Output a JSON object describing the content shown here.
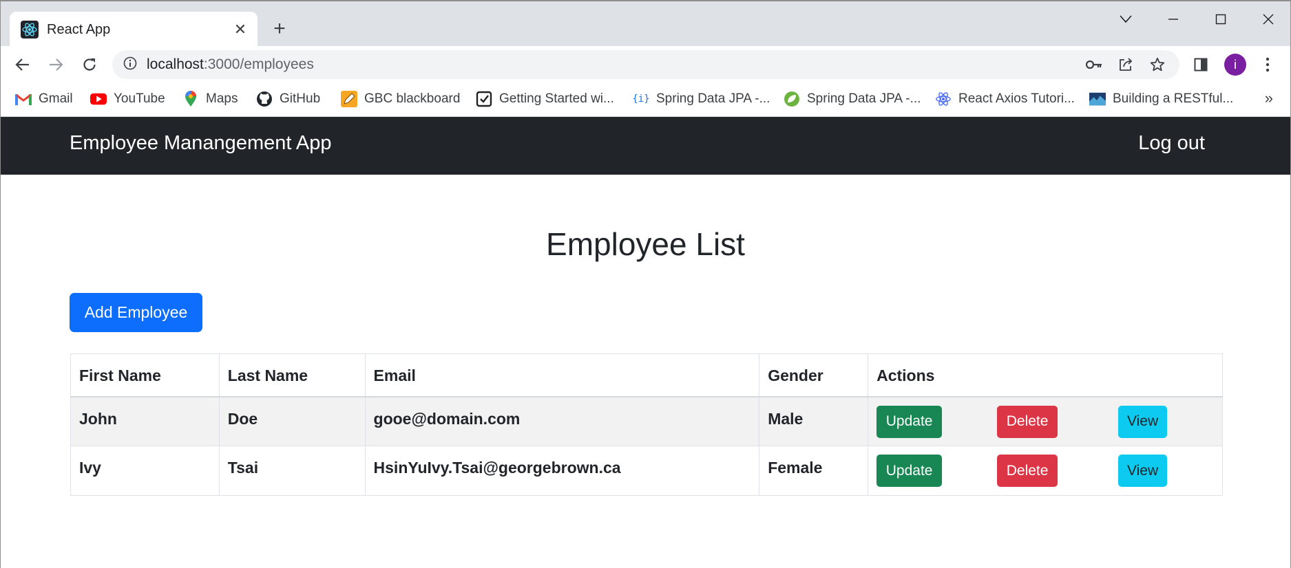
{
  "browser": {
    "tab": {
      "title": "React App",
      "favicon": "react-icon",
      "close_icon": "close-icon"
    },
    "new_tab_icon": "plus-icon",
    "window_controls": [
      "tab-search-icon",
      "minimize-icon",
      "maximize-icon",
      "close-window-icon"
    ],
    "nav": [
      "back-arrow-icon",
      "forward-arrow-icon",
      "reload-icon"
    ],
    "address": {
      "host": "localhost",
      "path": ":3000/employees"
    },
    "omnibox_icons": [
      "info-icon",
      "key-icon",
      "share-icon",
      "star-icon"
    ],
    "profile_initial": "i",
    "accent": "#7b1fa2",
    "bookmarks": [
      {
        "label": "Gmail",
        "icon": "gmail-icon"
      },
      {
        "label": "YouTube",
        "icon": "youtube-icon"
      },
      {
        "label": "Maps",
        "icon": "maps-icon"
      },
      {
        "label": "GitHub",
        "icon": "github-icon"
      },
      {
        "label": "GBC blackboard",
        "icon": "pencil-icon"
      },
      {
        "label": "Getting Started wi...",
        "icon": "page-icon"
      },
      {
        "label": "Spring Data JPA -...",
        "icon": "braces-icon"
      },
      {
        "label": "Spring Data JPA -...",
        "icon": "spring-leaf-icon"
      },
      {
        "label": "React Axios Tutori...",
        "icon": "react-icon"
      },
      {
        "label": "Building a RESTful...",
        "icon": "image-icon"
      }
    ],
    "bookmarks_more": "»"
  },
  "app": {
    "brand": "Employee Manangement App",
    "logout": "Log out",
    "navbar_color": "#212529"
  },
  "page": {
    "title": "Employee List",
    "add_button": "Add Employee",
    "table": {
      "headers": [
        "First Name",
        "Last Name",
        "Email",
        "Gender",
        "Actions"
      ],
      "rows": [
        {
          "first": "John",
          "last": "Doe",
          "email": "gooe@domain.com",
          "gender": "Male"
        },
        {
          "first": "Ivy",
          "last": "Tsai",
          "email": "HsinYuIvy.Tsai@georgebrown.ca",
          "gender": "Female"
        }
      ],
      "actions": {
        "update": "Update",
        "delete": "Delete",
        "view": "View"
      }
    },
    "colors": {
      "primary": "#0d6efd",
      "success": "#198754",
      "danger": "#dc3545",
      "info": "#0dcaf0"
    }
  }
}
